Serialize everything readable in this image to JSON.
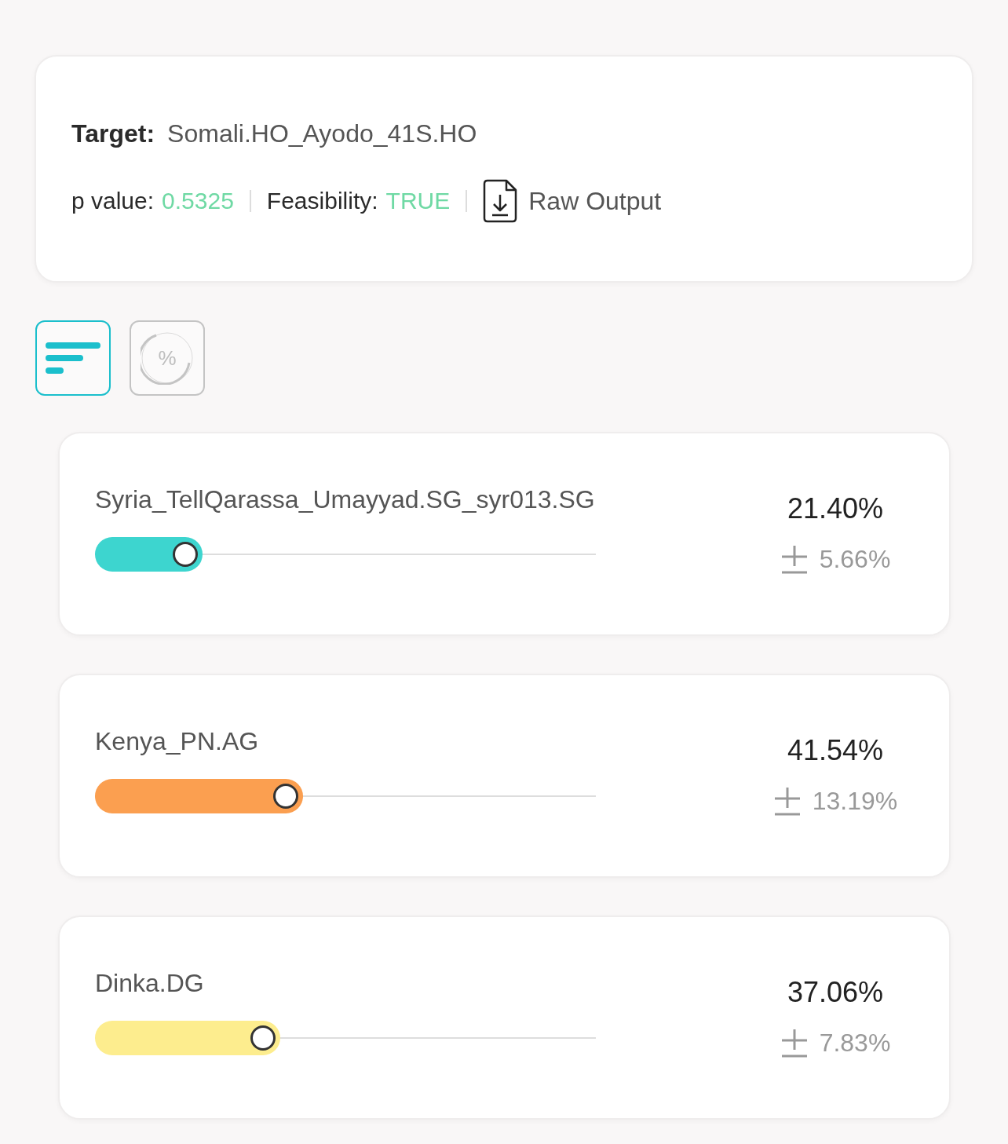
{
  "header": {
    "target_label": "Target:",
    "target_value": "Somali.HO_Ayodo_41S.HO",
    "p_value_label": "p value:",
    "p_value": "0.5325",
    "feasibility_label": "Feasibility:",
    "feasibility": "TRUE",
    "raw_output_link": "Raw Output"
  },
  "view_modes": [
    {
      "kind": "bars",
      "selected": true
    },
    {
      "kind": "percent",
      "symbol": "%",
      "selected": false
    }
  ],
  "sources": [
    {
      "name": "Syria_TellQarassa_Umayyad.SG_syr013.SG",
      "level": 0.214,
      "color": "#3dd5cf",
      "percent": "21.40%",
      "error": "5.66%"
    },
    {
      "name": "Kenya_PN.AG",
      "level": 0.4154,
      "color": "#fb9f50",
      "percent": "41.54%",
      "error": "13.19%"
    },
    {
      "name": "Dinka.DG",
      "level": 0.3706,
      "color": "#fded8e",
      "percent": "37.06%",
      "error": "7.83%"
    }
  ]
}
